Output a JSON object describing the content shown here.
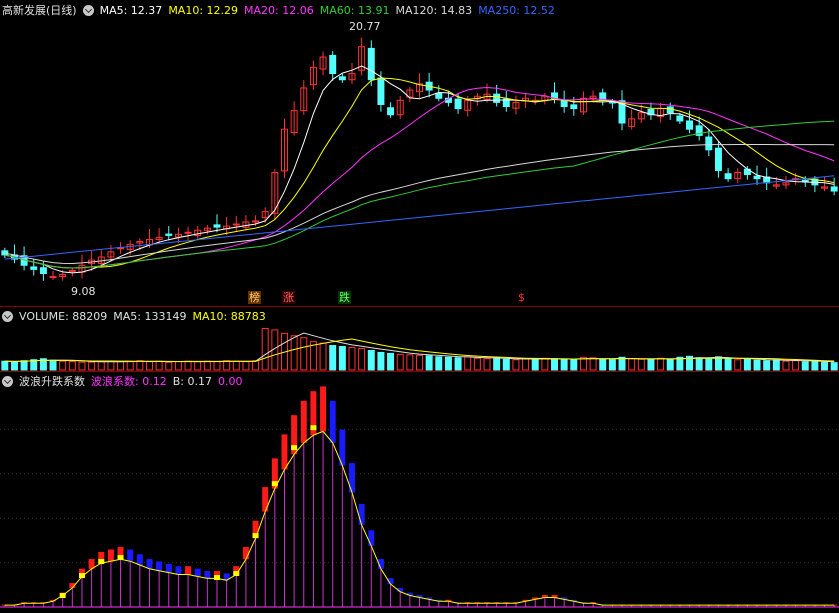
{
  "price_pane": {
    "title": "高新发展(日线)",
    "ma_labels": [
      {
        "text": "MA5: 12.37",
        "color": "#ffffff"
      },
      {
        "text": "MA10: 12.29",
        "color": "#ffff00"
      },
      {
        "text": "MA20: 12.06",
        "color": "#ff33ff"
      },
      {
        "text": "MA60: 13.91",
        "color": "#33cc33"
      },
      {
        "text": "MA120: 14.83",
        "color": "#d8d8d8"
      },
      {
        "text": "MA250: 12.52",
        "color": "#3366ff"
      }
    ],
    "high_label": "20.77",
    "low_label": "9.08",
    "event_tags": [
      {
        "text": "榜",
        "color": "#ffcc66",
        "bg": "#663300"
      },
      {
        "text": "涨",
        "color": "#ff6666",
        "bg": "#330000"
      },
      {
        "text": "跌",
        "color": "#66ff66",
        "bg": "#003300"
      },
      {
        "text": "$",
        "color": "#ff3333",
        "bg": "transparent"
      }
    ]
  },
  "volume_pane": {
    "labels": [
      {
        "text": "VOLUME: 88209",
        "color": "#e0e0e0"
      },
      {
        "text": "MA5: 133149",
        "color": "#e0e0e0"
      },
      {
        "text": "MA10: 88783",
        "color": "#ffff00"
      }
    ]
  },
  "osc_pane": {
    "labels": [
      {
        "text": "波浪升跌系数",
        "color": "#e0e0e0"
      },
      {
        "text": "波浪系数: 0.12",
        "color": "#ff33ff"
      },
      {
        "text": "B: 0.17",
        "color": "#e0e0e0"
      },
      {
        "text": "0.00",
        "color": "#ff33ff"
      }
    ]
  },
  "chart_data": {
    "type": "candlestick",
    "price_ylim": [
      8.5,
      21.5
    ],
    "closes": [
      10.2,
      10.0,
      9.7,
      9.5,
      9.3,
      9.15,
      9.25,
      9.45,
      9.7,
      9.95,
      10.1,
      10.35,
      10.55,
      10.7,
      10.85,
      10.95,
      11.05,
      11.15,
      11.2,
      11.3,
      11.4,
      11.5,
      11.55,
      11.6,
      11.7,
      11.8,
      11.85,
      12.3,
      14.2,
      16.3,
      17.2,
      18.3,
      19.3,
      19.8,
      19.0,
      18.7,
      19.0,
      20.3,
      18.7,
      17.5,
      17.0,
      17.7,
      18.2,
      18.5,
      18.2,
      17.8,
      17.6,
      17.3,
      17.7,
      17.9,
      18.0,
      17.6,
      17.4,
      17.6,
      17.8,
      17.7,
      17.9,
      17.8,
      17.4,
      17.3,
      17.8,
      17.9,
      17.7,
      17.6,
      16.6,
      16.8,
      17.1,
      17.0,
      17.3,
      17.1,
      16.7,
      16.3,
      16.0,
      15.3,
      14.3,
      13.9,
      14.2,
      14.1,
      13.9,
      13.7,
      13.6,
      13.7,
      13.9,
      13.8,
      13.6,
      13.5,
      13.3
    ],
    "volume_ma10_last": 88783,
    "volumes": [
      18,
      17,
      19,
      21,
      23,
      20,
      18,
      17,
      16,
      16,
      17,
      18,
      17,
      18,
      19,
      17,
      18,
      16,
      17,
      18,
      17,
      18,
      17,
      19,
      18,
      17,
      19,
      85,
      82,
      75,
      70,
      66,
      58,
      55,
      50,
      48,
      46,
      44,
      40,
      36,
      34,
      32,
      31,
      30,
      29,
      27,
      26,
      25,
      27,
      24,
      23,
      24,
      22,
      21,
      23,
      22,
      24,
      23,
      22,
      21,
      26,
      25,
      22,
      21,
      26,
      23,
      22,
      21,
      24,
      22,
      26,
      28,
      25,
      24,
      27,
      23,
      21,
      22,
      20,
      19,
      21,
      18,
      19,
      17,
      18,
      16,
      15
    ],
    "oscillator": [
      0.01,
      0.01,
      0.02,
      0.02,
      0.02,
      0.03,
      0.06,
      0.1,
      0.16,
      0.2,
      0.23,
      0.24,
      0.25,
      0.24,
      0.22,
      0.2,
      0.19,
      0.18,
      0.17,
      0.17,
      0.16,
      0.15,
      0.15,
      0.14,
      0.17,
      0.25,
      0.36,
      0.5,
      0.62,
      0.72,
      0.8,
      0.86,
      0.9,
      0.92,
      0.86,
      0.74,
      0.6,
      0.43,
      0.32,
      0.2,
      0.12,
      0.08,
      0.06,
      0.05,
      0.04,
      0.03,
      0.03,
      0.02,
      0.02,
      0.02,
      0.02,
      0.02,
      0.02,
      0.02,
      0.03,
      0.04,
      0.05,
      0.05,
      0.04,
      0.03,
      0.02,
      0.02,
      0.01,
      0.01,
      0.01,
      0.01,
      0.01,
      0.01,
      0.01,
      0.01,
      0.01,
      0.01,
      0.01,
      0.01,
      0.01,
      0.01,
      0.01,
      0.01,
      0.01,
      0.01,
      0.01,
      0.01,
      0.01,
      0.01,
      0.01,
      0.01,
      0.01
    ]
  }
}
